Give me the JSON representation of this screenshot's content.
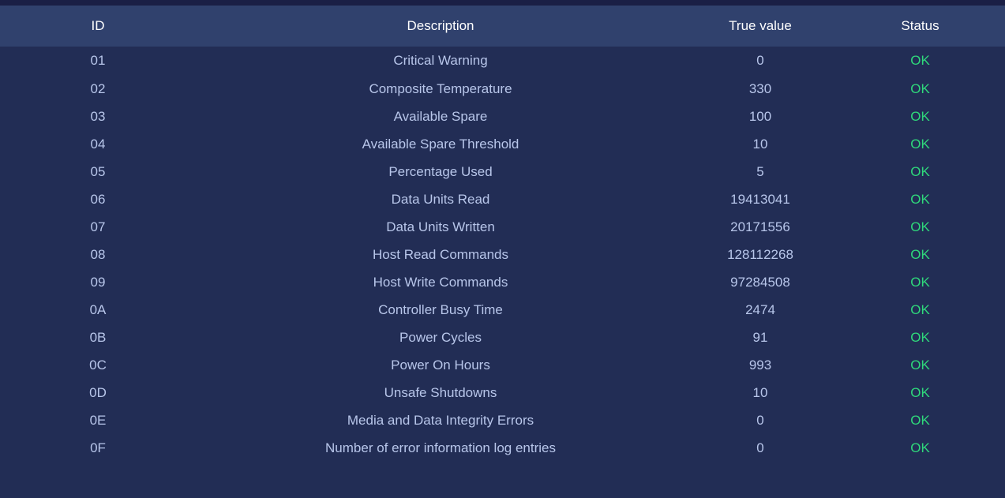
{
  "table": {
    "headers": {
      "id": "ID",
      "description": "Description",
      "true_value": "True value",
      "status": "Status"
    },
    "rows": [
      {
        "id": "01",
        "description": "Critical Warning",
        "value": "0",
        "status": "OK"
      },
      {
        "id": "02",
        "description": "Composite Temperature",
        "value": "330",
        "status": "OK"
      },
      {
        "id": "03",
        "description": "Available Spare",
        "value": "100",
        "status": "OK"
      },
      {
        "id": "04",
        "description": "Available Spare Threshold",
        "value": "10",
        "status": "OK"
      },
      {
        "id": "05",
        "description": "Percentage Used",
        "value": "5",
        "status": "OK"
      },
      {
        "id": "06",
        "description": "Data Units Read",
        "value": "19413041",
        "status": "OK"
      },
      {
        "id": "07",
        "description": "Data Units Written",
        "value": "20171556",
        "status": "OK"
      },
      {
        "id": "08",
        "description": "Host Read Commands",
        "value": "128112268",
        "status": "OK"
      },
      {
        "id": "09",
        "description": "Host Write Commands",
        "value": "97284508",
        "status": "OK"
      },
      {
        "id": "0A",
        "description": "Controller Busy Time",
        "value": "2474",
        "status": "OK"
      },
      {
        "id": "0B",
        "description": "Power Cycles",
        "value": "91",
        "status": "OK"
      },
      {
        "id": "0C",
        "description": "Power On Hours",
        "value": "993",
        "status": "OK"
      },
      {
        "id": "0D",
        "description": "Unsafe Shutdowns",
        "value": "10",
        "status": "OK"
      },
      {
        "id": "0E",
        "description": "Media and Data Integrity Errors",
        "value": "0",
        "status": "OK"
      },
      {
        "id": "0F",
        "description": "Number of error information log entries",
        "value": "0",
        "status": "OK"
      }
    ]
  },
  "colors": {
    "background": "#222d55",
    "header_background": "#30416d",
    "top_strip": "#1a1f45",
    "text": "#b8c6ea",
    "header_text": "#ffffff",
    "status_ok": "#2fd97b"
  }
}
